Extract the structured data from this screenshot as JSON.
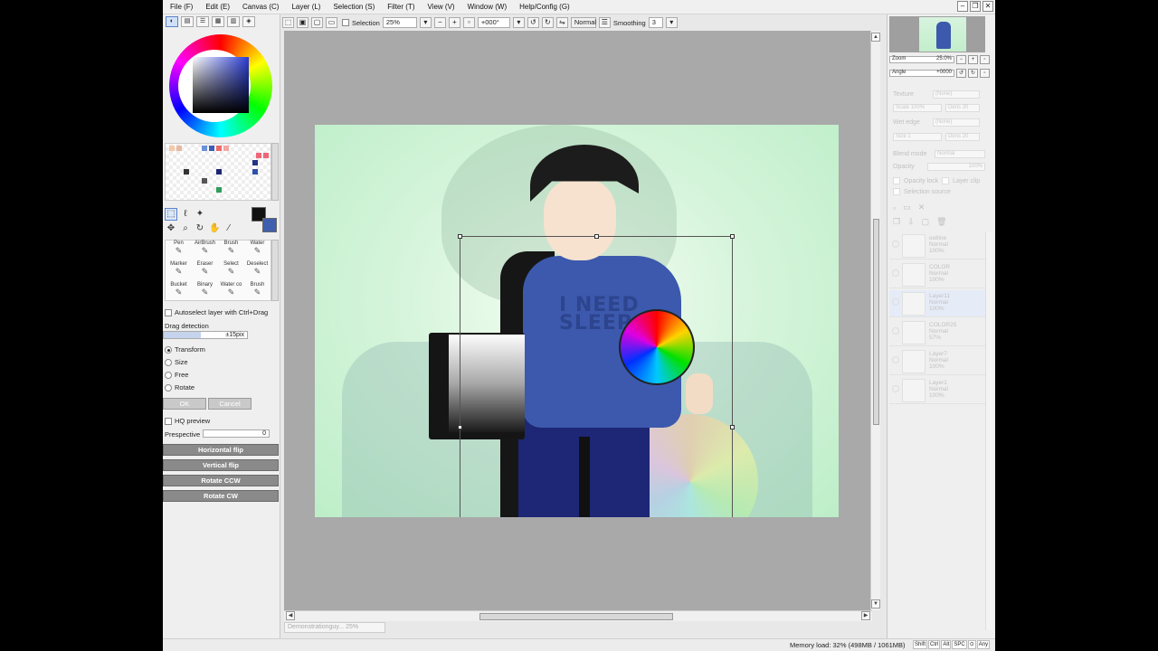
{
  "menu": [
    "File (F)",
    "Edit (E)",
    "Canvas (C)",
    "Layer (L)",
    "Selection (S)",
    "Filter (T)",
    "View (V)",
    "Window (W)",
    "Help/Config (G)"
  ],
  "window_controls": [
    "–",
    "❐",
    "✕"
  ],
  "toolbar": {
    "selection_label": "Selection",
    "zoom": "25%",
    "angle": "+000°",
    "blend": "Normal",
    "smoothing_label": "Smoothing",
    "smoothing_value": "3"
  },
  "color_tabs": [
    "◐",
    "▤",
    "☰",
    "▦",
    "▥",
    "◈"
  ],
  "brushes": [
    "Pen",
    "AirBrush",
    "Brush",
    "Water",
    "Marker",
    "Eraser",
    "Select",
    "Deselect",
    "Bucket",
    "Binary",
    "Water co",
    "Brush"
  ],
  "options": {
    "autoselect": "Autoselect layer with Ctrl+Drag",
    "drag_detection": "Drag detection",
    "drag_value": "±15pix",
    "transform": "Transform",
    "size": "Size",
    "free": "Free",
    "rotate": "Rotate",
    "ok": "OK",
    "cancel": "Cancel",
    "hq_preview": "HQ preview",
    "perspective": "Prespective",
    "perspective_value": "0",
    "horizontal_flip": "Horizontal flip",
    "vertical_flip": "Vertical flip",
    "rotate_ccw": "Rotate CCW",
    "rotate_cw": "Rotate CW"
  },
  "artwork": {
    "shirt_text_line1": "I NEED",
    "shirt_text_line2": "SLEEP"
  },
  "status": {
    "tab": "Demonstrationguy...  25%",
    "memory": "Memory load: 32% (498MB / 1061MB)",
    "keys": [
      "Shift",
      "Ctrl",
      "Alt",
      "SPC",
      "⊙",
      "Any"
    ]
  },
  "navigator": {
    "zoom_label": "Zoom",
    "zoom_value": "25.0%",
    "angle_label": "Angle",
    "angle_value": "+0000"
  },
  "layer_props": {
    "texture": "Texture",
    "texture_val": "(None)",
    "scale": "Scale",
    "scale_val": "100%",
    "dens": "Dens",
    "dens_val": "20",
    "wet_edge": "Wet edge",
    "wet_edge_val": "(None)",
    "size": "Size",
    "size_val": "1",
    "dens2_val": "20",
    "blend_mode": "Blend mode",
    "blend_val": "Normal",
    "opacity": "Opacity",
    "opacity_val": "100%",
    "opacity_lock": "Opacity lock",
    "layer_clip": "Layer clip",
    "selection_source": "Selection source"
  },
  "layers": [
    {
      "name": "outline",
      "mode": "Normal",
      "opacity": "100%"
    },
    {
      "name": "COLOR",
      "mode": "Normal",
      "opacity": "100%"
    },
    {
      "name": "Layer11",
      "mode": "Normal",
      "opacity": "100%"
    },
    {
      "name": "COLOR25",
      "mode": "Normal",
      "opacity": "57%"
    },
    {
      "name": "Layer7",
      "mode": "Normal",
      "opacity": "100%"
    },
    {
      "name": "Layer1",
      "mode": "Normal",
      "opacity": "100%"
    }
  ]
}
